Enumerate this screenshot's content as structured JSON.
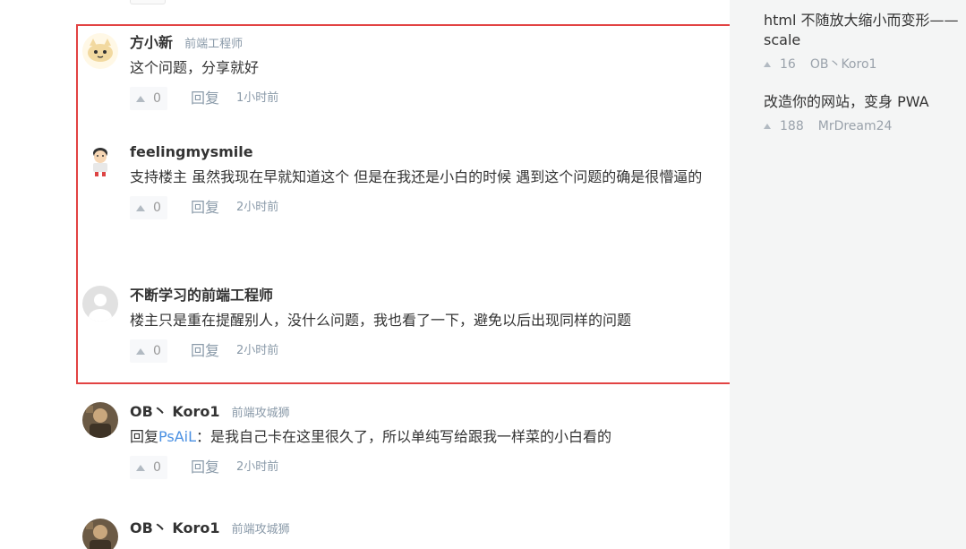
{
  "comments": [
    {
      "name": "方小新",
      "title": "前端工程师",
      "text": "这个问题，分享就好",
      "likes": "0",
      "reply_label": "回复",
      "time": "1小时前",
      "avatar_icon": "cartoon-cat-avatar"
    },
    {
      "name": "feelingmysmile",
      "title": "",
      "text": "支持楼主 虽然我现在早就知道这个 但是在我还是小白的时候 遇到这个问题的确是很懵逼的",
      "likes": "0",
      "reply_label": "回复",
      "time": "2小时前",
      "avatar_icon": "cartoon-boy-avatar"
    },
    {
      "name": "不断学习的前端工程师",
      "title": "",
      "text": "楼主只是重在提醒别人，没什么问题，我也看了一下，避免以后出现同样的问题",
      "likes": "0",
      "reply_label": "回复",
      "time": "2小时前",
      "avatar_icon": "default-user-avatar"
    },
    {
      "name": "OB丶 Koro1",
      "title": "前端攻城狮",
      "reply_prefix": "回复",
      "mention": "PsAiL",
      "text": "：是我自己卡在这里很久了，所以单纯写给跟我一样菜的小白看的",
      "likes": "0",
      "reply_label": "回复",
      "time": "2小时前",
      "avatar_icon": "photo-avatar"
    },
    {
      "name": "OB丶 Koro1",
      "title": "前端攻城狮",
      "avatar_icon": "photo-avatar"
    }
  ],
  "sidebar": {
    "items": [
      {
        "title": "html 不随放大缩小而变形——scale",
        "likes": "16",
        "author": "OB丶Koro1"
      },
      {
        "title": "改造你的网站，变身 PWA",
        "likes": "188",
        "author": "MrDream24"
      }
    ]
  },
  "colors": {
    "highlight_border": "#e24343",
    "mention": "#4a90e2",
    "sidebar_bg": "#f4f5f5",
    "meta_text": "#8a9aa9"
  }
}
